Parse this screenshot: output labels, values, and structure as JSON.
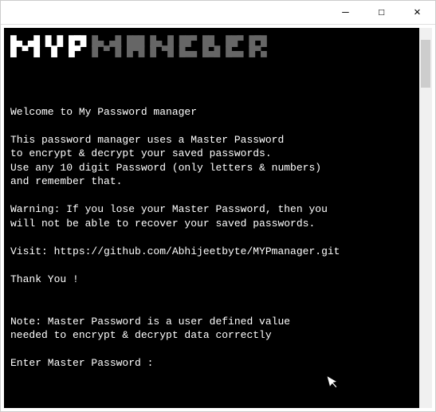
{
  "titlebar": {
    "minimize": "—",
    "maximize": "☐",
    "close": "✕"
  },
  "logo": {
    "bright": "MYP",
    "gray": "MANEGER"
  },
  "content": {
    "welcome": "Welcome to My Password manager",
    "blank": "",
    "desc1": "This password manager uses a Master Password",
    "desc2": "to encrypt & decrypt your saved passwords.",
    "desc3": "Use any 10 digit Password (only letters & numbers)",
    "desc4": "and remember that.",
    "warn1": "Warning: If you lose your Master Password, then you",
    "warn2": "will not be able to recover your saved passwords.",
    "visit": "Visit: https://github.com/Abhijeetbyte/MYPmanager.git",
    "thanks": "Thank You !",
    "note1": "Note: Master Password is a user defined value",
    "note2": "needed to encrypt & decrypt data correctly",
    "prompt": "Enter Master Password : "
  }
}
